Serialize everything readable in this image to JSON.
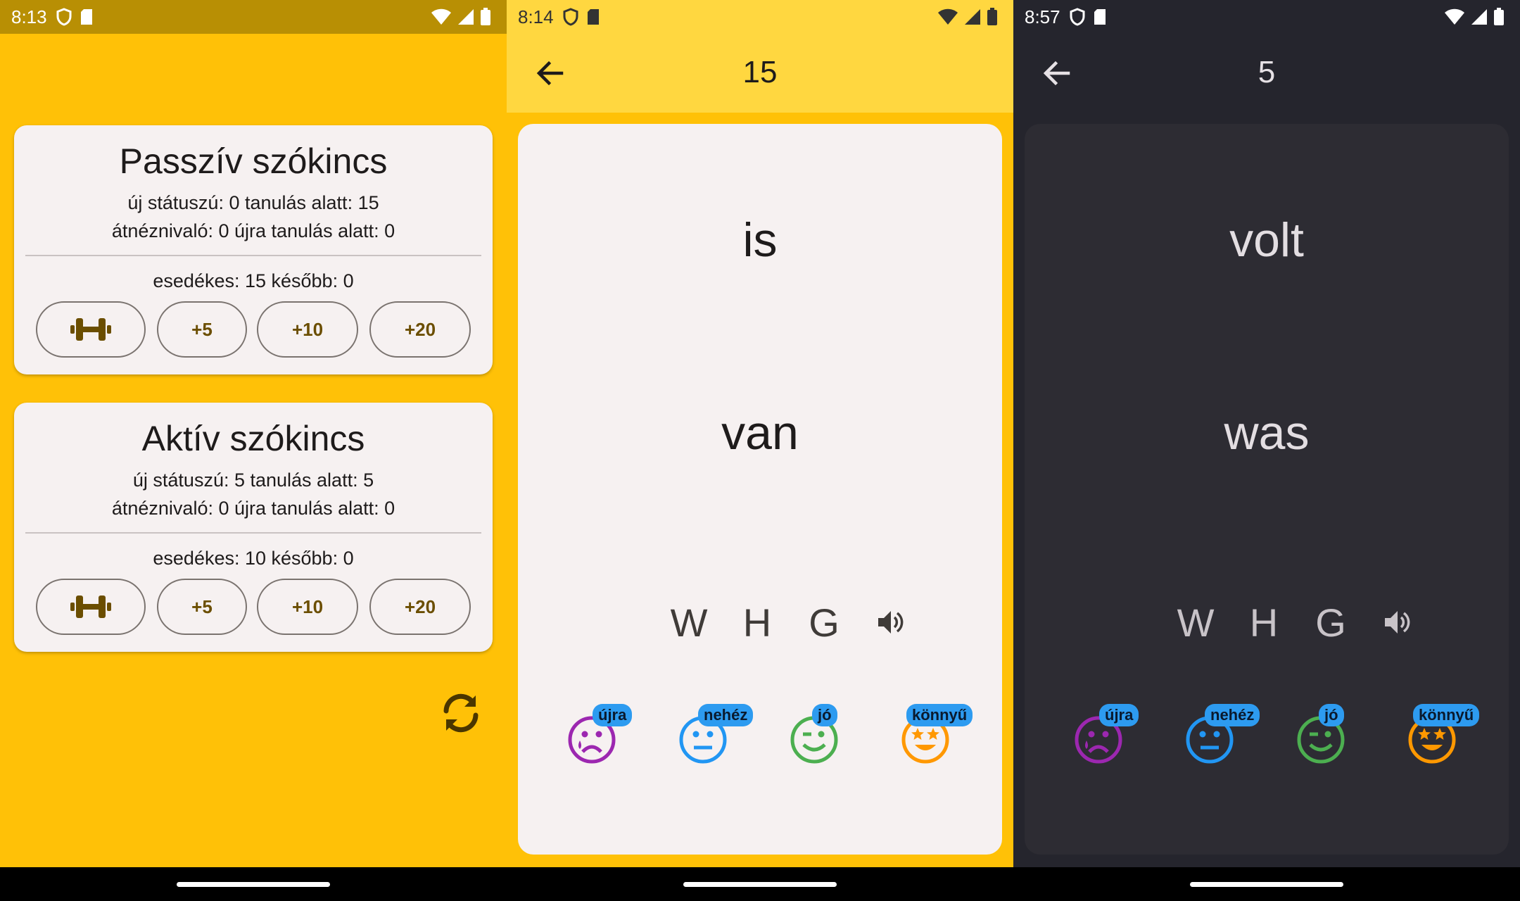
{
  "status_bars": [
    {
      "time": "8:13"
    },
    {
      "time": "8:14"
    },
    {
      "time": "8:57"
    }
  ],
  "decks": [
    {
      "title": "Passzív szókincs",
      "line1": "új státuszú: 0  tanulás alatt: 15",
      "line2": "átnéznivaló: 0  újra tanulás alatt: 0",
      "line3": "esedékes: 15  később: 0",
      "buttons": [
        "+5",
        "+10",
        "+20"
      ]
    },
    {
      "title": "Aktív szókincs",
      "line1": "új státuszú: 5  tanulás alatt: 5",
      "line2": "átnéznivaló: 0  újra tanulás alatt: 0",
      "line3": "esedékes: 10  később: 0",
      "buttons": [
        "+5",
        "+10",
        "+20"
      ]
    }
  ],
  "icons": {
    "train": "dumbbell-icon",
    "refresh": "refresh-icon",
    "back": "arrow-back-icon",
    "speak": "speaker-icon"
  },
  "review_light": {
    "count": "15",
    "front": "is",
    "back": "van"
  },
  "review_dark": {
    "count": "5",
    "front": "volt",
    "back": "was"
  },
  "tools": [
    "W",
    "H",
    "G"
  ],
  "ratings": [
    {
      "label": "újra",
      "color": "#9C27B0"
    },
    {
      "label": "nehéz",
      "color": "#2196F3"
    },
    {
      "label": "jó",
      "color": "#4CAF50"
    },
    {
      "label": "könnyű",
      "color": "#FF9800"
    }
  ],
  "colors": {
    "primary": "#FFC107",
    "appbar_light": "#FFD740",
    "dark_bg": "#25252D",
    "badge": "#2D9BF0"
  }
}
